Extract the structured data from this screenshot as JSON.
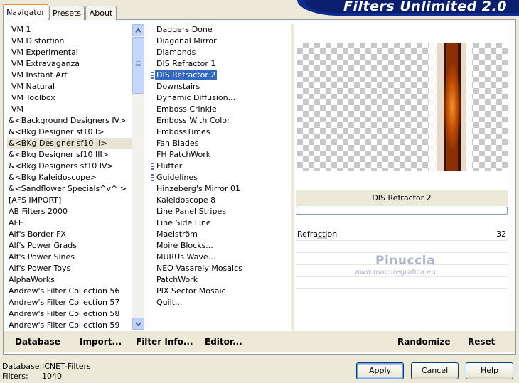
{
  "title": "Filters Unlimited 2.0",
  "tabs": [
    "Navigator",
    "Presets",
    "About"
  ],
  "categories": [
    "VM 1",
    "VM Distortion",
    "VM Experimental",
    "VM Extravaganza",
    "VM Instant Art",
    "VM Natural",
    "VM Toolbox",
    "VM",
    "&<Background Designers IV>",
    "&<Bkg Designer sf10 I>",
    "&<BKg Designer sf10 II>",
    "&<Bkg Designer sf10 III>",
    "&<Bkg Designers sf10 IV>",
    "&<Bkg Kaleidoscope>",
    "&<Sandflower Specials^v^ >",
    "[AFS IMPORT]",
    "AB Filters 2000",
    "AFH",
    "Alf's Border FX",
    "Alf's Power Grads",
    "Alf's Power Sines",
    "Alf's Power Toys",
    "AlphaWorks",
    "Andrew's Filter Collection 56",
    "Andrew's Filter Collection 57",
    "Andrew's Filter Collection 58",
    "Andrew's Filter Collection 59"
  ],
  "highlighted_category": "&<BKg Designer sf10 II>",
  "filters": [
    "Daggers Done",
    "Diagonal Mirror",
    "Diamonds",
    "DIS Refractor 1",
    "DIS Refractor 2",
    "Downstairs",
    "Dynamic Diffusion...",
    "Emboss Crinkle",
    "Emboss With Color",
    "EmbossTimes",
    "Fan Blades",
    "FH PatchWork",
    "Flutter",
    "Guidelines",
    "Hinzeberg's Mirror 01",
    "Kaleidoscope 8",
    "Line Panel Stripes",
    "Line Side Line",
    "Maelström",
    "Moiré Blocks...",
    "MURUs Wave...",
    "NEO Vasarely Mosaics",
    "PatchWork",
    "PIX Sector Mosaic",
    "Quilt..."
  ],
  "selected_filter": "DIS Refractor 2",
  "filter_title": "DIS Refractor 2",
  "parameter": {
    "label": "Refraction",
    "value": "32"
  },
  "watermark": {
    "name": "Pinuccia",
    "site": "www.maidiregrafica.eu"
  },
  "toolbar": {
    "database": "Database",
    "import": "Import...",
    "filter_info": "Filter Info...",
    "editor": "Editor...",
    "randomize": "Randomize",
    "reset": "Reset"
  },
  "buttons": {
    "apply": "Apply",
    "cancel": "Cancel",
    "help": "Help"
  },
  "status": {
    "database_label": "Database:",
    "database_value": "ICNET-Filters",
    "filters_label": "Filters:",
    "filters_value": "1040"
  },
  "colors": {
    "selection": "#316ac5",
    "banner": "#0c2b8c",
    "window": "#ece9d8"
  }
}
